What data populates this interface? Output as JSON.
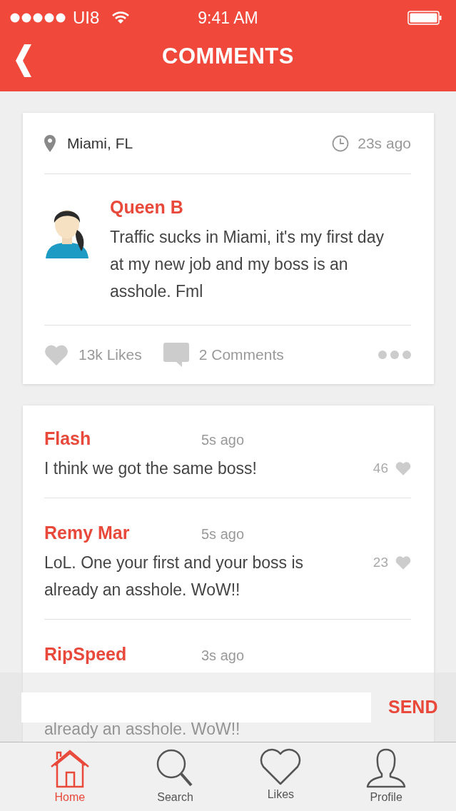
{
  "status_bar": {
    "carrier": "UI8",
    "time": "9:41 AM"
  },
  "header": {
    "title": "COMMENTS"
  },
  "post": {
    "location": "Miami, FL",
    "time": "23s ago",
    "author": "Queen B",
    "text": "Traffic sucks in Miami, it's my first day at my new job and my boss is an asshole. Fml",
    "likes": "13k Likes",
    "comments": "2 Comments"
  },
  "comments": [
    {
      "author": "Flash",
      "time": "5s ago",
      "text": "I think we got the same boss!",
      "likes": "46"
    },
    {
      "author": "Remy Mar",
      "time": "5s ago",
      "text": "LoL. One your first and your boss is already an asshole. WoW!!",
      "likes": "23"
    },
    {
      "author": "RipSpeed",
      "time": "3s ago",
      "text": "already an asshole. WoW!!",
      "partial": true
    }
  ],
  "composer": {
    "send": "SEND"
  },
  "tab_bar": [
    {
      "kind": "home",
      "label": "Home",
      "selected": true
    },
    {
      "kind": "search",
      "label": "Search",
      "selected": false
    },
    {
      "kind": "likes",
      "label": "Likes",
      "selected": false
    },
    {
      "kind": "profile",
      "label": "Profile",
      "selected": false
    }
  ]
}
